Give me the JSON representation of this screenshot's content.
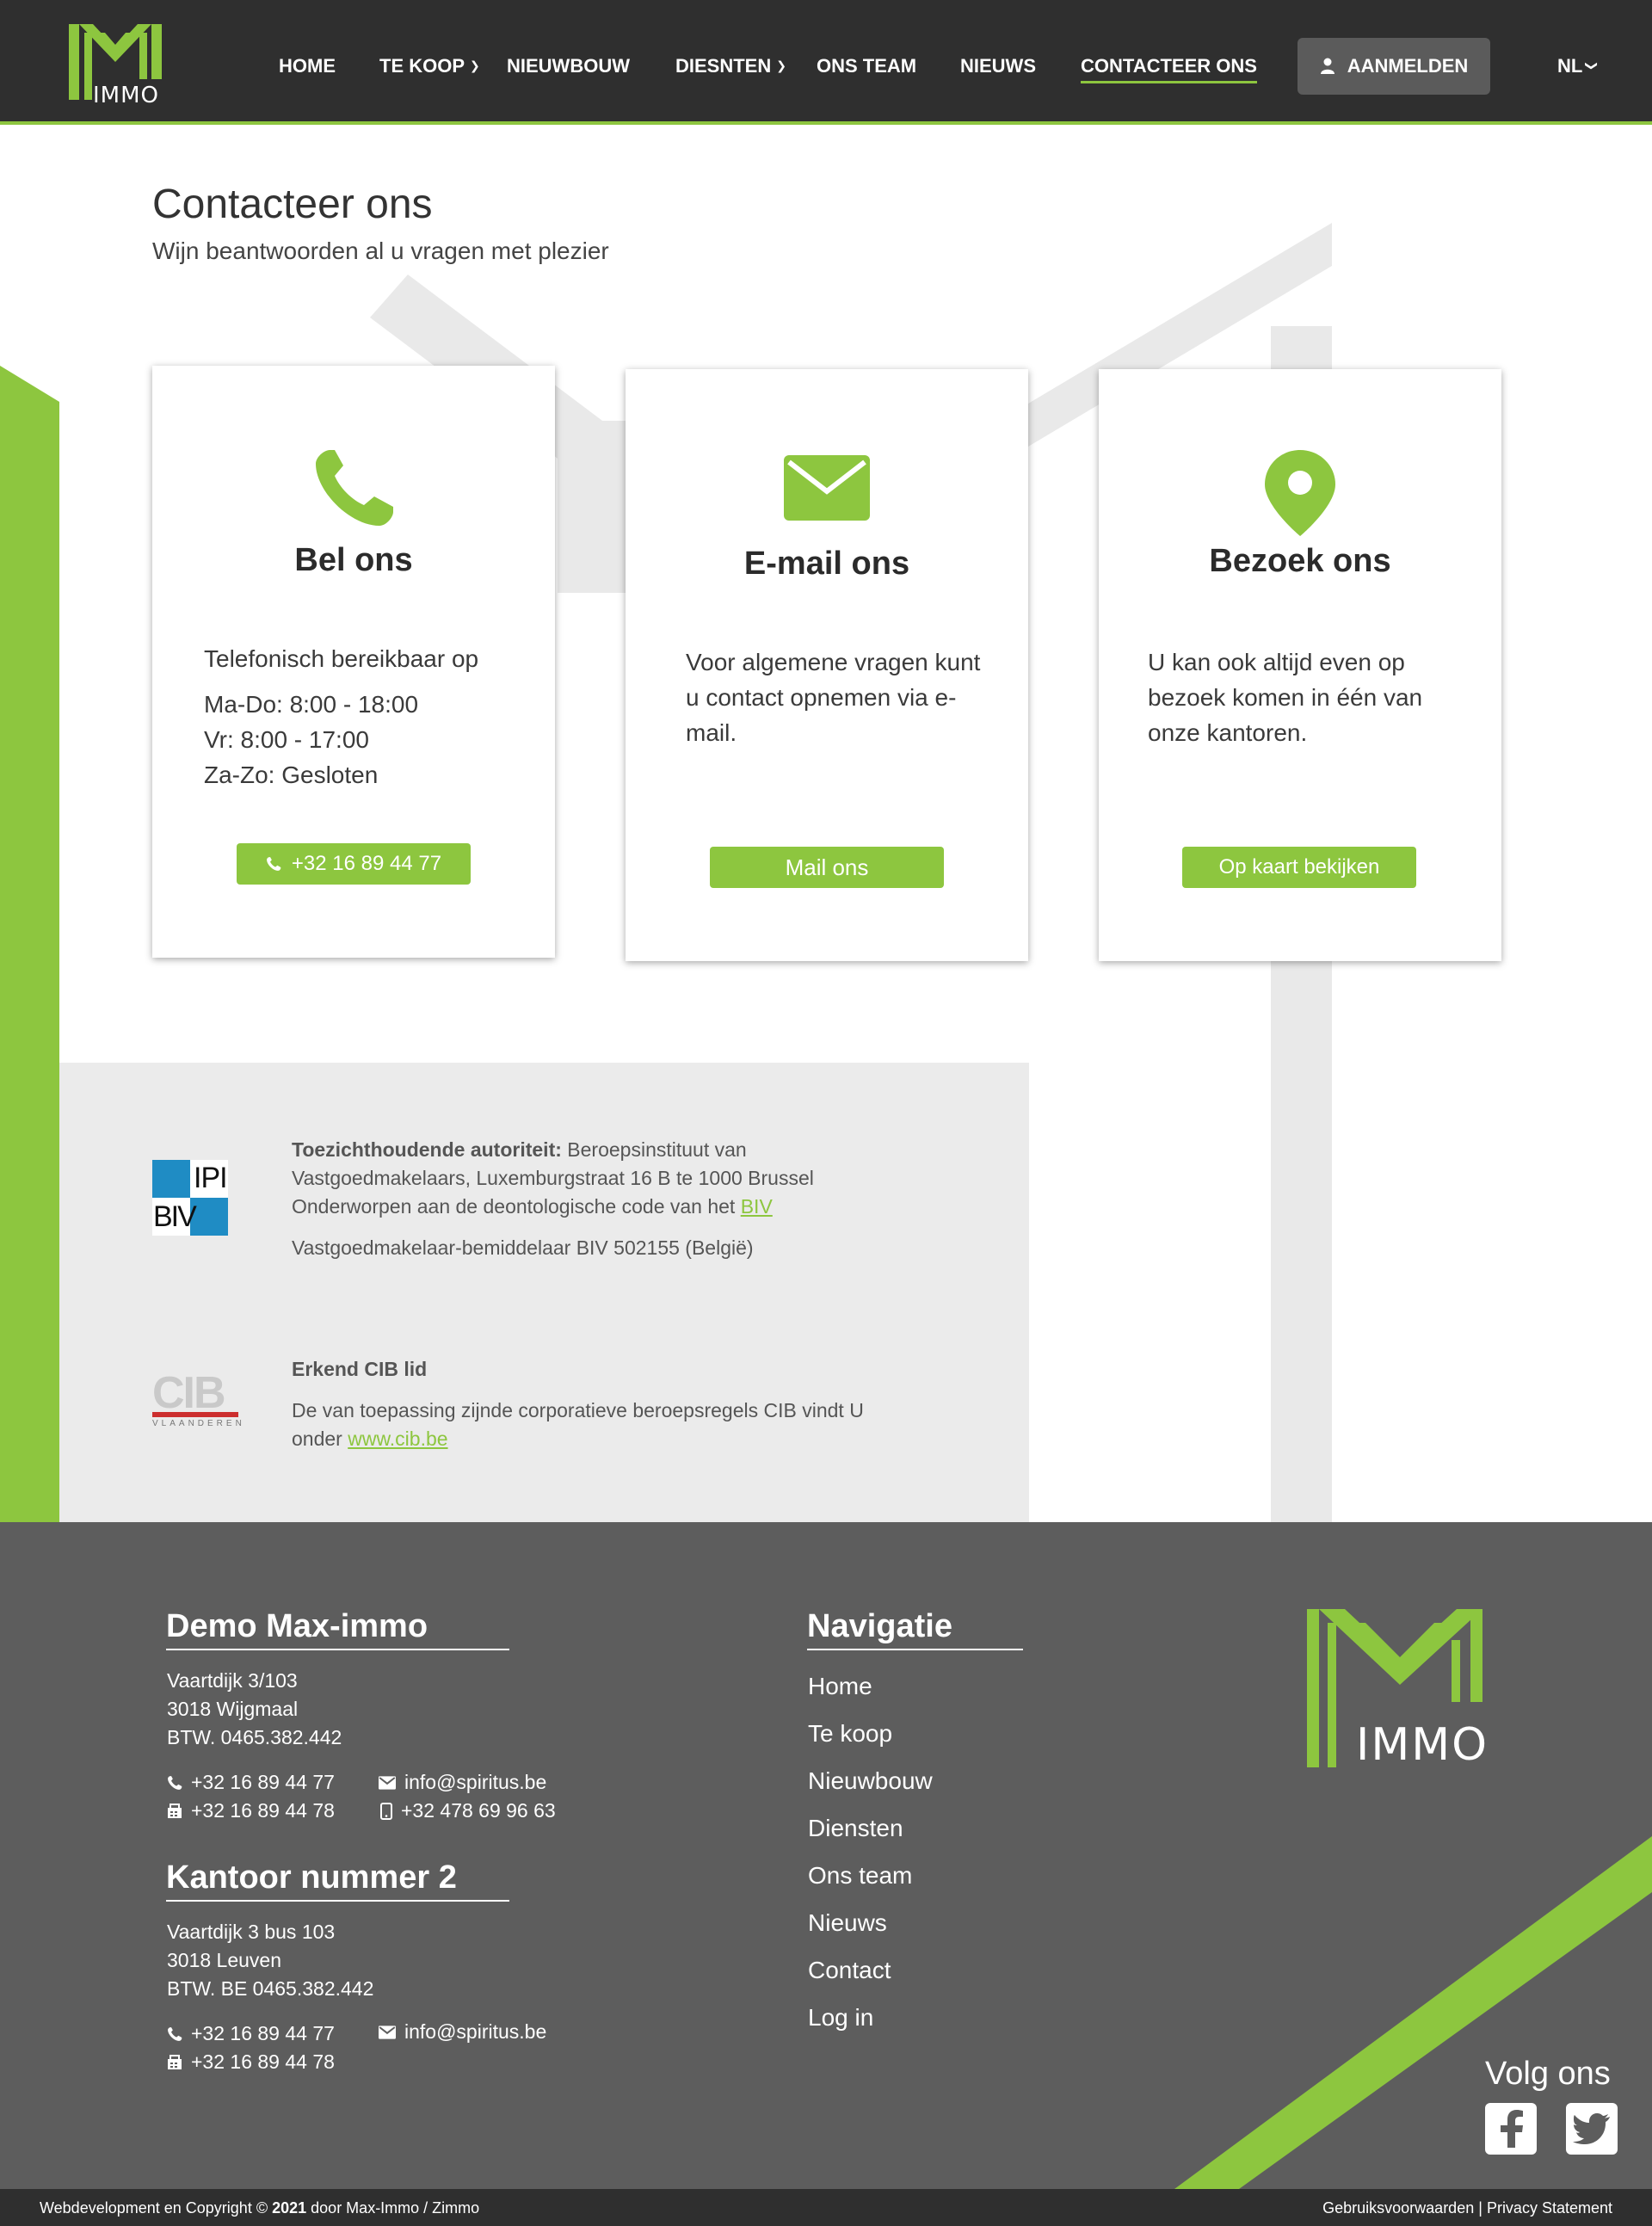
{
  "brand": {
    "logo_text": "IMMO",
    "accent": "#8dc63f",
    "dark": "#2f2f2f"
  },
  "nav": {
    "items": [
      {
        "label": "HOME"
      },
      {
        "label": "TE KOOP"
      },
      {
        "label": "NIEUWBOUW"
      },
      {
        "label": "DIESNTEN"
      },
      {
        "label": "ONS TEAM"
      },
      {
        "label": "NIEUWS"
      },
      {
        "label": "CONTACTEER ONS"
      }
    ],
    "login_label": "AANMELDEN",
    "lang": "NL"
  },
  "page": {
    "title": "Contacteer ons",
    "subtitle": "Wijn beantwoorden al u vragen met plezier"
  },
  "cards": [
    {
      "title": "Bel ons",
      "icon": "phone-icon",
      "lines": [
        "Telefonisch bereikbaar op",
        "Ma-Do: 8:00 - 18:00",
        "Vr: 8:00 - 17:00",
        "Za-Zo: Gesloten"
      ],
      "cta": "+32 16 89 44 77"
    },
    {
      "title": "E-mail ons",
      "icon": "envelope-icon",
      "text": "Voor algemene vragen kunt u contact opnemen via e-mail.",
      "cta": "Mail ons"
    },
    {
      "title": "Bezoek ons",
      "icon": "map-pin-icon",
      "text": "U kan ook altijd even op bezoek komen in één van onze kantoren.",
      "cta": "Op kaart bekijken"
    }
  ],
  "regulatory": {
    "biv": {
      "logo_text_1": "IPI",
      "logo_text_2": "BIV",
      "label": "Toezichthoudende autoriteit:",
      "text": "Beroepsinstituut van Vastgoedmakelaars, Luxemburgstraat 16 B te 1000 Brussel",
      "deontology": "Onderworpen aan de deontologische code van het",
      "link": "BIV",
      "registration": "Vastgoedmakelaar-bemiddelaar BIV 502155 (België)"
    },
    "cib": {
      "logo_text": "CIB",
      "logo_sub": "VLAANDEREN",
      "label": "Erkend CIB lid",
      "text": "De van toepassing zijnde corporatieve beroepsregels CIB vindt U onder",
      "link": "www.cib.be"
    }
  },
  "footer": {
    "office1": {
      "title": "Demo Max-immo",
      "address": [
        "Vaartdijk 3/103",
        "3018 Wijgmaal",
        "BTW. 0465.382.442"
      ],
      "phone": "+32 16 89 44 77",
      "fax": "+32 16 89 44 78",
      "email": "info@spiritus.be",
      "mobile": "+32 478 69 96 63"
    },
    "office2": {
      "title": "Kantoor nummer 2",
      "address": [
        "Vaartdijk 3 bus 103",
        "3018 Leuven",
        "BTW. BE 0465.382.442"
      ],
      "phone": "+32 16 89 44 77",
      "fax": "+32 16 89 44 78",
      "email": "info@spiritus.be"
    },
    "nav_title": "Navigatie",
    "nav_links": [
      "Home",
      "Te koop",
      "Nieuwbouw",
      "Diensten",
      "Ons team",
      "Nieuws",
      "Contact",
      "Log in"
    ],
    "follow": "Volg ons"
  },
  "bottom": {
    "copyright_prefix": "Webdevelopment en Copyright ©",
    "year": "2021",
    "copyright_suffix": "door Max-Immo / Zimmo",
    "terms": "Gebruiksvoorwaarden",
    "separator": "|",
    "privacy": "Privacy Statement"
  }
}
